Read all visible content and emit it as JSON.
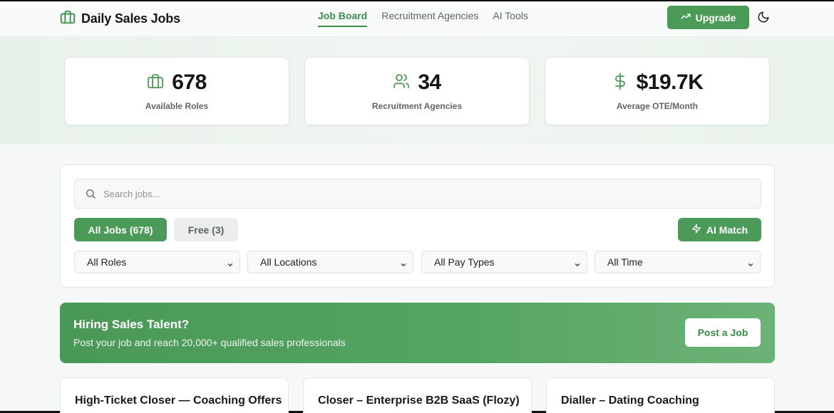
{
  "header": {
    "brand": "Daily Sales Jobs",
    "nav": [
      {
        "label": "Job Board",
        "active": true
      },
      {
        "label": "Recruitment Agencies",
        "active": false
      },
      {
        "label": "AI Tools",
        "active": false
      }
    ],
    "upgrade_label": "Upgrade",
    "theme_icon": "moon-icon"
  },
  "stats": [
    {
      "value": "678",
      "label": "Available Roles",
      "icon": "briefcase-icon"
    },
    {
      "value": "34",
      "label": "Recruitment Agencies",
      "icon": "users-icon"
    },
    {
      "value": "$19.7K",
      "label": "Average OTE/Month",
      "icon": "dollar-icon"
    }
  ],
  "filters": {
    "search_placeholder": "Search jobs...",
    "tabs": [
      {
        "label": "All Jobs (678)",
        "active": true
      },
      {
        "label": "Free (3)",
        "active": false
      }
    ],
    "ai_match_label": "AI Match",
    "selects": [
      {
        "value": "All Roles"
      },
      {
        "value": "All Locations"
      },
      {
        "value": "All Pay Types"
      },
      {
        "value": "All Time"
      }
    ]
  },
  "banner": {
    "title": "Hiring Sales Talent?",
    "subtitle": "Post your job and reach 20,000+ qualified sales professionals",
    "button_label": "Post a Job"
  },
  "jobs": [
    {
      "title": "High-Ticket Closer — Coaching Offers"
    },
    {
      "title": "Closer – Enterprise B2B SaaS (Flozy)"
    },
    {
      "title": "Dialler – Dating Coaching"
    }
  ],
  "colors": {
    "accent": "#4c9a57",
    "accent_dark": "#3d8e4b",
    "page_bg": "#f6f8f7"
  }
}
